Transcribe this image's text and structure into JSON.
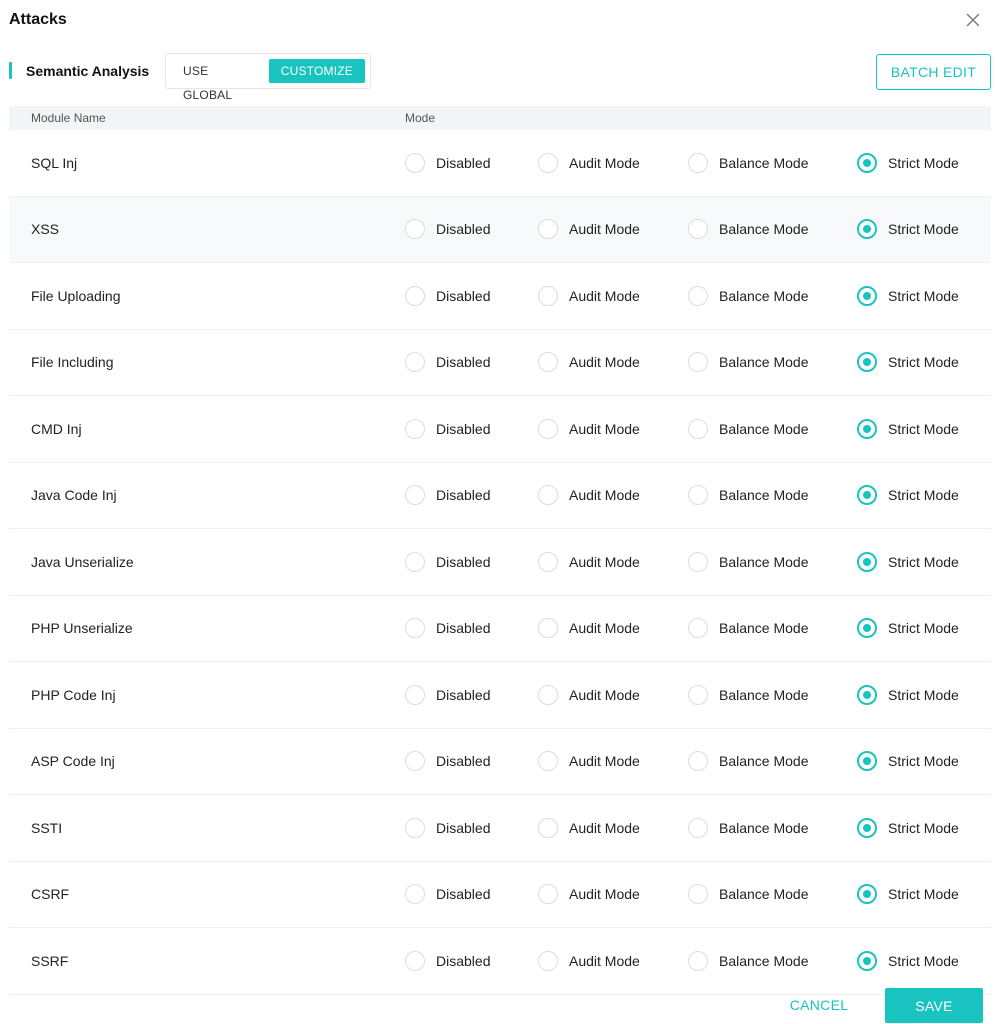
{
  "dialog": {
    "title": "Attacks",
    "close_icon": "close-icon"
  },
  "section": {
    "title": "Semantic Analysis",
    "scope_options": [
      {
        "label": "USE GLOBAL",
        "selected": false
      },
      {
        "label": "CUSTOMIZE",
        "selected": true
      }
    ],
    "batch_edit_label": "BATCH EDIT"
  },
  "table": {
    "headers": {
      "module": "Module Name",
      "mode": "Mode"
    },
    "mode_options": [
      "Disabled",
      "Audit Mode",
      "Balance Mode",
      "Strict Mode"
    ],
    "rows": [
      {
        "name": "SQL Inj",
        "mode": "Strict Mode"
      },
      {
        "name": "XSS",
        "mode": "Strict Mode"
      },
      {
        "name": "File Uploading",
        "mode": "Strict Mode"
      },
      {
        "name": "File Including",
        "mode": "Strict Mode"
      },
      {
        "name": "CMD Inj",
        "mode": "Strict Mode"
      },
      {
        "name": "Java Code Inj",
        "mode": "Strict Mode"
      },
      {
        "name": "Java Unserialize",
        "mode": "Strict Mode"
      },
      {
        "name": "PHP Unserialize",
        "mode": "Strict Mode"
      },
      {
        "name": "PHP Code Inj",
        "mode": "Strict Mode"
      },
      {
        "name": "ASP Code Inj",
        "mode": "Strict Mode"
      },
      {
        "name": "SSTI",
        "mode": "Strict Mode"
      },
      {
        "name": "CSRF",
        "mode": "Strict Mode"
      },
      {
        "name": "SSRF",
        "mode": "Strict Mode"
      }
    ],
    "highlighted_row_index": 1
  },
  "footer": {
    "cancel_label": "CANCEL",
    "save_label": "SAVE"
  },
  "colors": {
    "accent": "#19c3bf",
    "header_bg": "#f2f4f5",
    "row_highlight": "#f7f9fa"
  }
}
